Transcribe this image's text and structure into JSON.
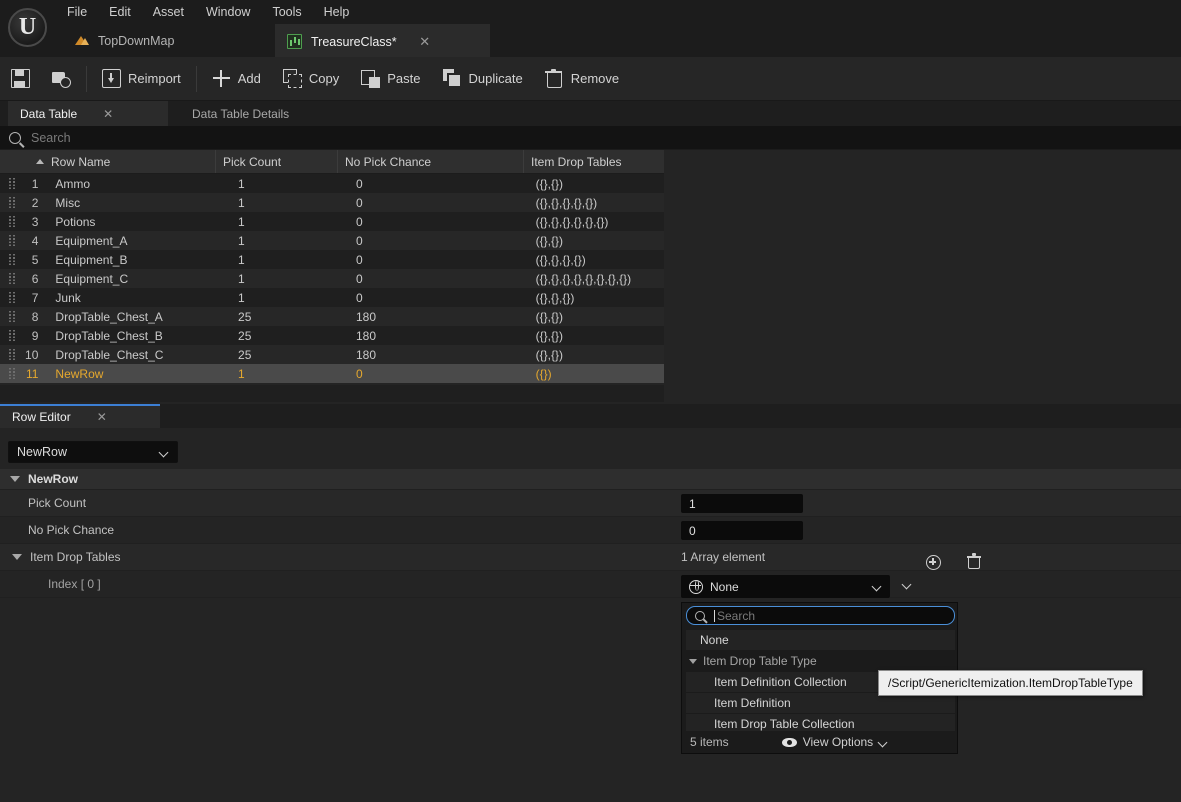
{
  "app": {
    "logo_glyph": "U"
  },
  "menubar": {
    "items": [
      {
        "label": "File"
      },
      {
        "label": "Edit"
      },
      {
        "label": "Asset"
      },
      {
        "label": "Window"
      },
      {
        "label": "Tools"
      },
      {
        "label": "Help"
      }
    ]
  },
  "asset_tabs": [
    {
      "label": "TopDownMap",
      "icon": "map-icon",
      "active": false,
      "closable": false
    },
    {
      "label": "TreasureClass*",
      "icon": "data-table-icon",
      "active": true,
      "closable": true,
      "close_glyph": "✕"
    }
  ],
  "toolbar": {
    "save_label": "",
    "browse_label": "",
    "buttons": [
      {
        "label": "Reimport",
        "icon": "reimport-icon"
      },
      {
        "label": "Add",
        "icon": "plus-icon"
      },
      {
        "label": "Copy",
        "icon": "copy-icon"
      },
      {
        "label": "Paste",
        "icon": "paste-icon"
      },
      {
        "label": "Duplicate",
        "icon": "duplicate-icon"
      },
      {
        "label": "Remove",
        "icon": "trash-icon"
      }
    ]
  },
  "panel_tabs": [
    {
      "label": "Data Table",
      "active": true,
      "close_glyph": "✕"
    },
    {
      "label": "Data Table Details",
      "active": false
    }
  ],
  "search": {
    "placeholder": "Search",
    "value": "",
    "icon": "search-icon"
  },
  "table": {
    "columns": [
      "Row Name",
      "Pick Count",
      "No Pick Chance",
      "Item Drop Tables"
    ],
    "sort_column": "Row Name",
    "sort_direction": "ascending",
    "rows": [
      {
        "index": "1",
        "name": "Ammo",
        "pick_count": "1",
        "no_pick_chance": "0",
        "item_drop_tables": "({},{})"
      },
      {
        "index": "2",
        "name": "Misc",
        "pick_count": "1",
        "no_pick_chance": "0",
        "item_drop_tables": "({},{},{},{},{})"
      },
      {
        "index": "3",
        "name": "Potions",
        "pick_count": "1",
        "no_pick_chance": "0",
        "item_drop_tables": "({},{},{},{},{},{})"
      },
      {
        "index": "4",
        "name": "Equipment_A",
        "pick_count": "1",
        "no_pick_chance": "0",
        "item_drop_tables": "({},{})"
      },
      {
        "index": "5",
        "name": "Equipment_B",
        "pick_count": "1",
        "no_pick_chance": "0",
        "item_drop_tables": "({},{},{},{})"
      },
      {
        "index": "6",
        "name": "Equipment_C",
        "pick_count": "1",
        "no_pick_chance": "0",
        "item_drop_tables": "({},{},{},{},{},{},{},{})"
      },
      {
        "index": "7",
        "name": "Junk",
        "pick_count": "1",
        "no_pick_chance": "0",
        "item_drop_tables": "({},{},{})"
      },
      {
        "index": "8",
        "name": "DropTable_Chest_A",
        "pick_count": "25",
        "no_pick_chance": "180",
        "item_drop_tables": "({},{})"
      },
      {
        "index": "9",
        "name": "DropTable_Chest_B",
        "pick_count": "25",
        "no_pick_chance": "180",
        "item_drop_tables": "({},{})"
      },
      {
        "index": "10",
        "name": "DropTable_Chest_C",
        "pick_count": "25",
        "no_pick_chance": "180",
        "item_drop_tables": "({},{})"
      },
      {
        "index": "11",
        "name": "NewRow",
        "pick_count": "1",
        "no_pick_chance": "0",
        "item_drop_tables": "({})",
        "selected": true
      }
    ],
    "selected_row_color": "#e5a82e"
  },
  "row_editor": {
    "tab_label": "Row Editor",
    "tab_close_glyph": "✕",
    "row_selector_value": "NewRow",
    "category_label": "NewRow",
    "properties": [
      {
        "label": "Pick Count",
        "value": "1"
      },
      {
        "label": "No Pick Chance",
        "value": "0"
      }
    ],
    "array_property": {
      "label": "Item Drop Tables",
      "count_label": "1 Array element",
      "add_icon": "add-element-icon",
      "delete_icon": "delete-all-elements-icon",
      "element_label": "Index [ 0 ]",
      "element_value": "None",
      "element_icon": "object-asset-icon"
    }
  },
  "dropdown": {
    "search_placeholder": "Search",
    "search_value": "",
    "none_label": "None",
    "group_label": "Item Drop Table Type",
    "items": [
      "Item Definition Collection",
      "Item Definition",
      "Item Drop Table Collection"
    ],
    "count_label": "5 items",
    "view_options_label": "View Options",
    "view_options_icon": "eye-icon"
  },
  "tooltip": {
    "text": "/Script/GenericItemization.ItemDropTableType"
  }
}
